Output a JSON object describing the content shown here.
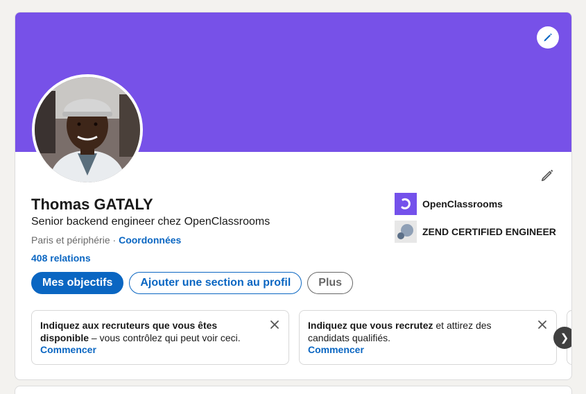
{
  "profile": {
    "name": "Thomas GATALY",
    "headline": "Senior backend engineer chez OpenClassrooms",
    "location": "Paris et périphérie",
    "separator": " · ",
    "contact_link": "Coordonnées",
    "relations": "408 relations"
  },
  "actions": {
    "primary": "Mes objectifs",
    "add_section": "Ajouter une section au profil",
    "more": "Plus"
  },
  "companies": [
    {
      "name": "OpenClassrooms",
      "logo": "openclassrooms-logo"
    },
    {
      "name": "ZEND CERTIFIED ENGINEER",
      "logo": "zend-logo"
    }
  ],
  "recommendations": [
    {
      "bold": "Indiquez aux recruteurs que vous êtes disponible",
      "rest": " – vous contrôlez qui peut voir ceci.",
      "cta": "Commencer"
    },
    {
      "bold": "Indiquez que vous recrutez",
      "rest": " et attirez des candidats qualifiés.",
      "cta": "Commencer"
    }
  ],
  "colors": {
    "cover": "#7751e8",
    "accent": "#0a66c2",
    "background": "#f3f2ef"
  },
  "icons": {
    "cover_edit": "pencil-icon",
    "profile_edit": "pencil-icon",
    "dismiss": "close-icon",
    "carousel_next": "chevron-right-icon"
  },
  "carousel": {
    "next_glyph": "❯"
  }
}
